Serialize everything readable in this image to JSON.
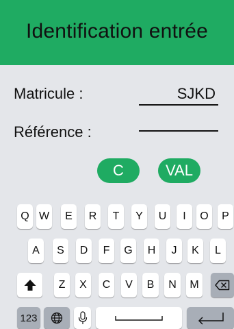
{
  "header": {
    "title": "Identification entrée"
  },
  "form": {
    "matricule": {
      "label": "Matricule :",
      "value": "SJKD"
    },
    "reference": {
      "label": "Référence :",
      "value": ""
    }
  },
  "actions": {
    "cancel_label": "C",
    "validate_label": "VAL"
  },
  "keyboard": {
    "row1": [
      "Q",
      "W",
      "E",
      "R",
      "T",
      "Y",
      "U",
      "I",
      "O",
      "P"
    ],
    "row2": [
      "A",
      "S",
      "D",
      "F",
      "G",
      "H",
      "J",
      "K",
      "L"
    ],
    "row3": [
      "Z",
      "X",
      "C",
      "V",
      "B",
      "N",
      "M"
    ],
    "numbers_label": "123",
    "icons": [
      "shift-icon",
      "backspace-icon",
      "globe-icon",
      "microphone-icon",
      "space-icon",
      "return-icon"
    ]
  },
  "colors": {
    "accent": "#1fab62",
    "background": "#e4e6ea",
    "key": "#ffffff",
    "function_key": "#a8aeb7"
  }
}
